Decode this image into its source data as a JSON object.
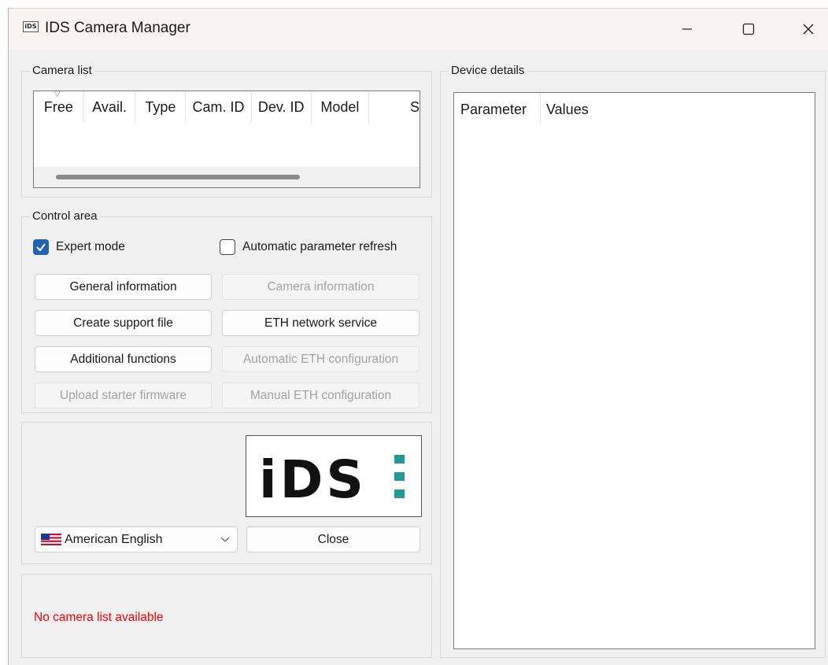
{
  "window": {
    "title": "IDS Camera Manager",
    "app_icon_text": "iDS"
  },
  "camera_list": {
    "label": "Camera list",
    "columns": [
      "Free",
      "Avail.",
      "Type",
      "Cam. ID",
      "Dev. ID",
      "Model",
      "S"
    ]
  },
  "control_area": {
    "label": "Control area",
    "expert_mode": {
      "label": "Expert mode",
      "checked": true
    },
    "auto_refresh": {
      "label": "Automatic parameter refresh",
      "checked": false
    },
    "buttons": {
      "general_information": "General information",
      "camera_information": "Camera information",
      "create_support_file": "Create support file",
      "eth_network_service": "ETH network service",
      "additional_functions": "Additional functions",
      "automatic_eth_configuration": "Automatic ETH configuration",
      "upload_starter_firmware": "Upload starter firmware",
      "manual_eth_configuration": "Manual ETH configuration"
    }
  },
  "bottom": {
    "logo_text": "iDS",
    "language": "American English",
    "close_label": "Close",
    "status": "No camera list available"
  },
  "device_details": {
    "label": "Device details",
    "columns": [
      "Parameter",
      "Values"
    ]
  },
  "colors": {
    "accent": "#1f63b3",
    "logo_teal": "#1f9a94",
    "status_error": "#ff0000"
  }
}
